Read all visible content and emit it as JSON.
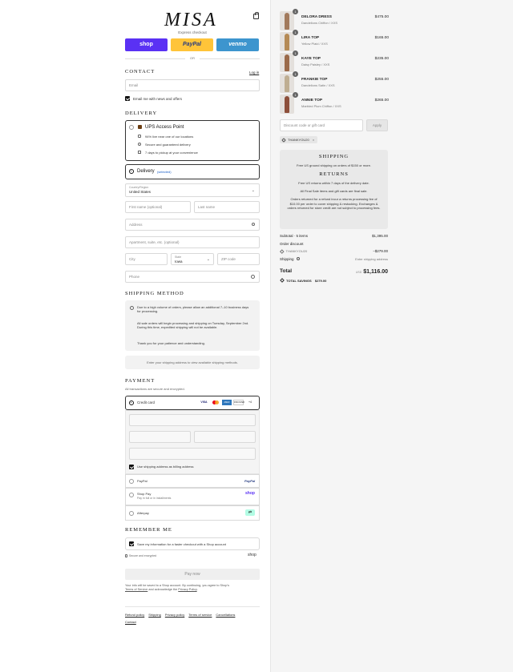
{
  "header": {
    "logo": "MISA",
    "express_checkout": "Express checkout",
    "or": "OR"
  },
  "express_buttons": {
    "shop": "shop",
    "paypal": "PayPal",
    "venmo": "venmo"
  },
  "contact": {
    "title": "CONTACT",
    "login": "Log in",
    "email_placeholder": "Email",
    "news_label": "Email me with news and offers"
  },
  "delivery": {
    "title": "DELIVERY",
    "ups_label": "UPS Access Point",
    "ups_features": [
      "94% live near one of our locations",
      "Secure and guaranteed delivery",
      "7 days to pickup at your convenience"
    ],
    "ship_label": "Delivery",
    "ship_selected": "(selected)",
    "country_label": "Country/Region",
    "country_value": "United States",
    "first_name": "First name (optional)",
    "last_name": "Last name",
    "address": "Address",
    "apartment": "Apartment, suite, etc. (optional)",
    "city": "City",
    "state_label": "State",
    "state_value": "Iowa",
    "zip": "ZIP code",
    "phone": "Phone"
  },
  "shipping_method": {
    "title": "SHIPPING METHOD",
    "notice1": "Due to a high volume of orders, please allow an additional 7–10 business days for processing.",
    "notice2": "All sale orders will begin processing and shipping on Tuesday, September 2nd. During this time, expedited shipping will not be available.",
    "notice3": "Thank you for your patience and understanding.",
    "enter_address": "Enter your shipping address to view available shipping methods."
  },
  "payment": {
    "title": "PAYMENT",
    "subtitle": "All transactions are secure and encrypted.",
    "credit_card": "Credit card",
    "card_logos": [
      "VISA",
      "MC",
      "AMEX",
      "DISCOVER",
      "+4"
    ],
    "billing_same": "Use shipping address as billing address",
    "paypal": "PayPal",
    "paypal_logo": "PayPal",
    "shop_pay": "Shop Pay",
    "shop_pay_sub": "Pay in full or in installments",
    "shop_pay_logo": "shop",
    "afterpay": "Afterpay"
  },
  "remember": {
    "title": "REMEMBER ME",
    "save_label": "Save my information for a faster checkout with a Shop account",
    "secure": "Secure and encrypted",
    "shop_logo": "shop"
  },
  "pay_now": "Pay now",
  "legal": {
    "text": "Your info will be saved to a Shop account. By continuing, you agree to Shop's",
    "terms": "Terms of Service",
    "and": " and acknowledge the ",
    "privacy": "Privacy Policy",
    "end": "."
  },
  "footer_links": [
    "Refund policy",
    "Shipping",
    "Privacy policy",
    "Terms of service",
    "Cancellations",
    "Contact"
  ],
  "cart": [
    {
      "qty": "1",
      "name": "DELORA DRESS",
      "variant": "Dandelions Chiffon / XXS",
      "price": "$475.00",
      "color": "#a27a5c"
    },
    {
      "qty": "1",
      "name": "LIRA TOP",
      "variant": "Yellow Plaid / XXS",
      "price": "$165.00",
      "color": "#b58a55"
    },
    {
      "qty": "1",
      "name": "KAYE TOP",
      "variant": "Daisy Paisley / XXS",
      "price": "$235.00",
      "color": "#9a6a4a"
    },
    {
      "qty": "1",
      "name": "FRANKIE TOP",
      "variant": "Dandelions Satin / XXS",
      "price": "$255.00",
      "color": "#bfae92"
    },
    {
      "qty": "1",
      "name": "ANNIE TOP",
      "variant": "Marbled Plum Chiffon / XXS",
      "price": "$265.00",
      "color": "#8d4f3a"
    }
  ],
  "discount": {
    "placeholder": "Discount code or gift card",
    "apply": "Apply",
    "code": "THANKYOU20"
  },
  "policy": {
    "shipping_title": "SHIPPING",
    "shipping_text": "Free US ground shipping on orders of $150 or more.",
    "returns_title": "RETURNS",
    "returns1": "Free US returns within 7 days of the delivery date.",
    "returns2": "All Final Sale items and gift cards are final sale.",
    "returns3": "Orders returned for a refund incur a returns processing fee of $10.00 per order to cover shipping & restocking. Exchanges & orders returned for store credit are not subject to processing fees."
  },
  "summary": {
    "subtotal_label": "Subtotal · 5 items",
    "subtotal": "$1,395.00",
    "order_discount": "Order discount",
    "discount_code": "THANKYOU20",
    "discount_value": "−$279.00",
    "shipping_label": "Shipping",
    "shipping_value": "Enter shipping address",
    "total_label": "Total",
    "currency": "USD",
    "total": "$1,116.00",
    "savings_label": "TOTAL SAVINGS",
    "savings": "$279.00"
  }
}
